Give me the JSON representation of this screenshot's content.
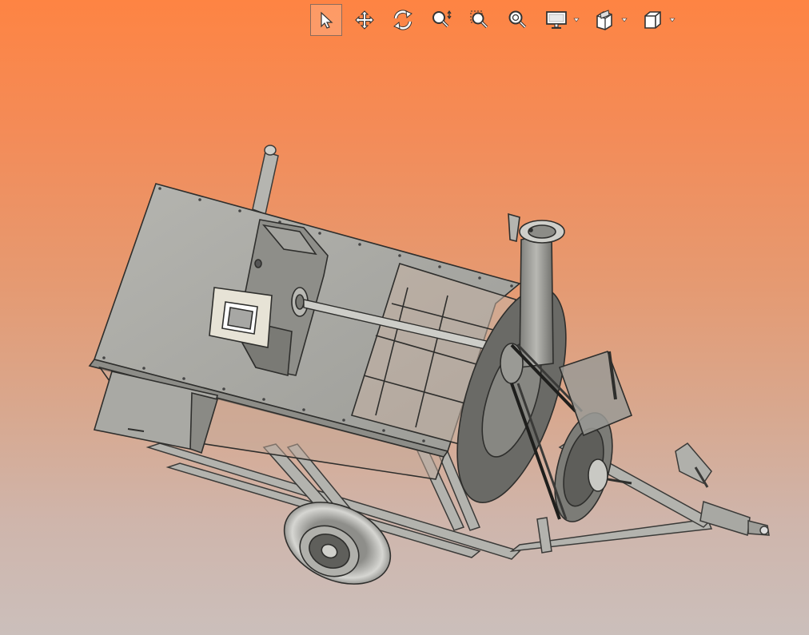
{
  "toolbar": {
    "tools": [
      {
        "icon": "select-arrow-icon",
        "active": true
      },
      {
        "icon": "pan-icon",
        "active": false
      },
      {
        "icon": "rotate-icon",
        "active": false
      },
      {
        "icon": "zoom-icon",
        "active": false
      },
      {
        "icon": "zoom-area-icon",
        "active": false
      },
      {
        "icon": "zoom-fit-icon",
        "active": false
      }
    ],
    "dropdowns": [
      {
        "icon": "display-mode-icon"
      },
      {
        "icon": "section-view-icon"
      },
      {
        "icon": "view-orientation-cube-icon"
      }
    ]
  },
  "colors": {
    "background_top": "#fe8443",
    "background_bottom": "#cbbfbb",
    "part_fill": "#a9a9a4",
    "part_dark": "#3c3c3a",
    "part_light": "#d9d9d4",
    "icon_dark": "#4a4a4a",
    "icon_light": "#ffffff"
  },
  "model": {
    "name_icon": "trailer-mounted-shredder-3d-model"
  }
}
